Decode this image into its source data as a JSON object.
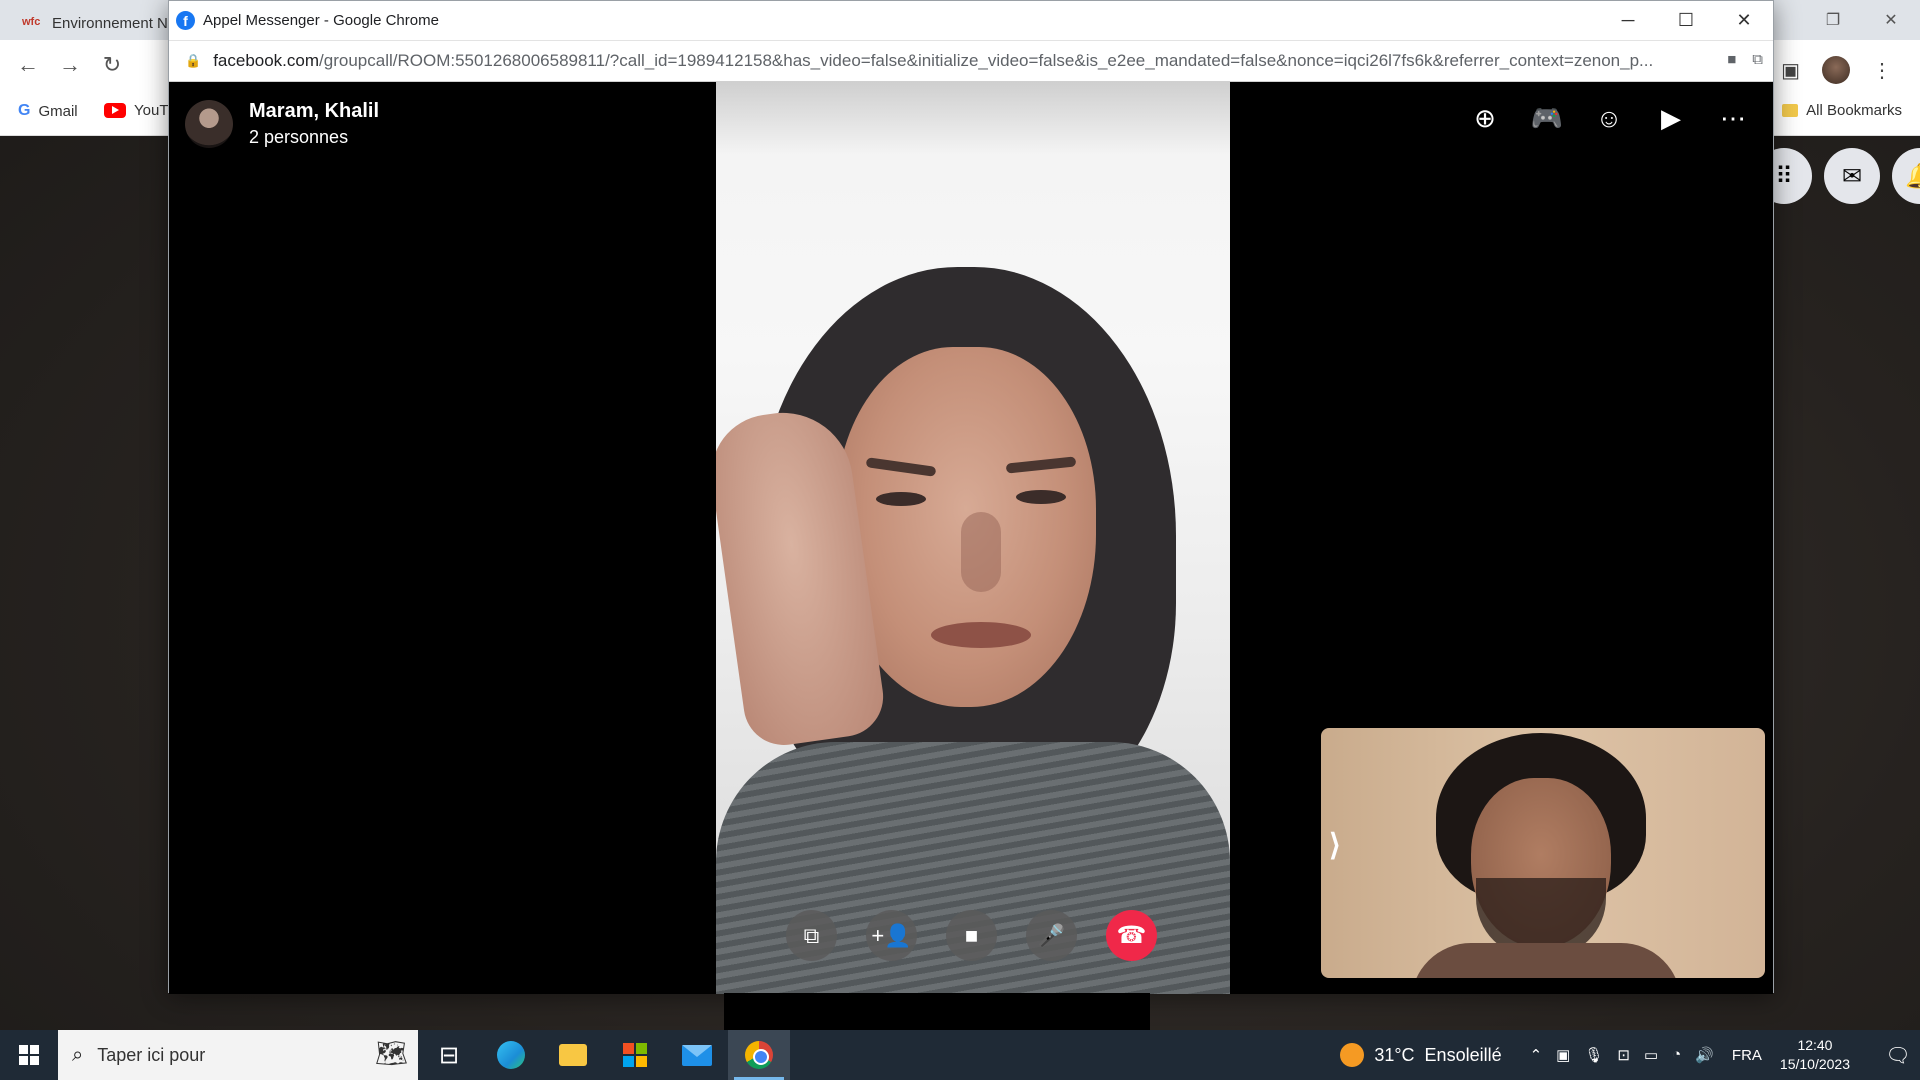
{
  "background_browser": {
    "tab_title": "Environnement N",
    "bookmarks": [
      "Gmail",
      "YouT"
    ],
    "all_bookmarks": "All Bookmarks"
  },
  "popup": {
    "window_title": "Appel Messenger - Google Chrome",
    "url_host": "facebook.com",
    "url_path": "/groupcall/ROOM:5501268006589811/?call_id=1989412158&has_video=false&initialize_video=false&is_e2ee_mandated=false&nonce=iqci26l7fs6k&referrer_context=zenon_p..."
  },
  "call": {
    "title": "Maram, Khalil",
    "participants": "2 personnes",
    "header_tools": [
      "add-icon",
      "gamepad-icon",
      "effects-icon",
      "share-screen-icon",
      "more-icon"
    ],
    "controls": [
      "switch-camera-icon",
      "add-person-icon",
      "camera-icon",
      "microphone-icon",
      "end-call-icon"
    ],
    "end_call_color": "#f02849"
  },
  "taskbar": {
    "search_placeholder": "Taper ici pour",
    "weather_temp": "31°C",
    "weather_text": "Ensoleillé",
    "language": "FRA",
    "time": "12:40",
    "date": "15/10/2023",
    "accent": "#76b9ed"
  }
}
